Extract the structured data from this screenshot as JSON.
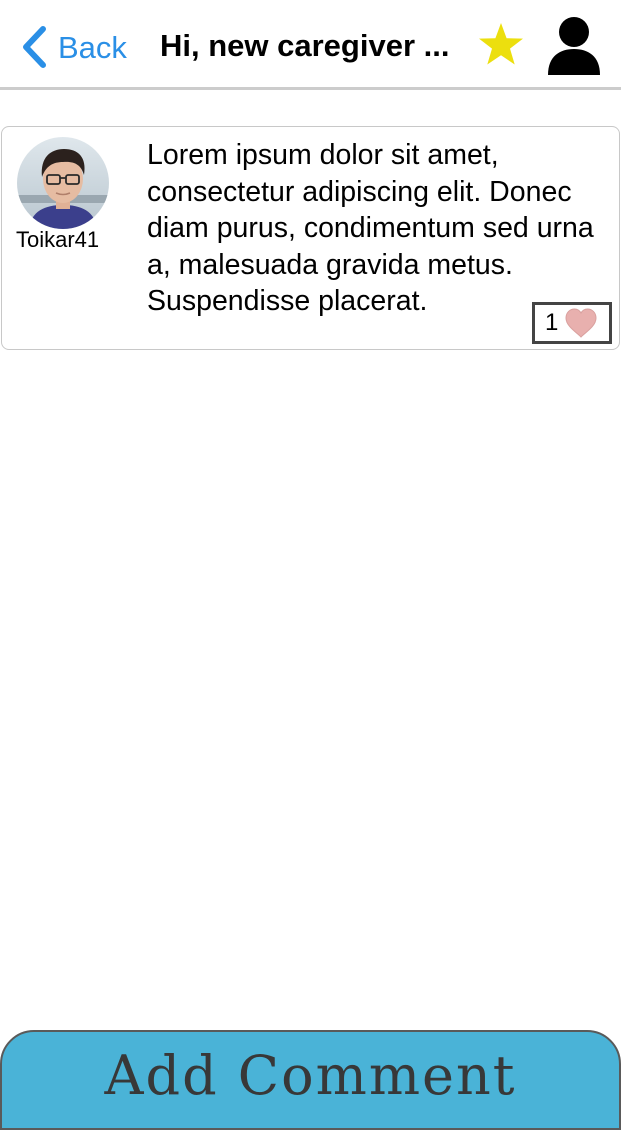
{
  "header": {
    "back_label": "Back",
    "title": "Hi, new caregiver ...",
    "favorite_color": "#ecdf0e",
    "accent_color": "#2a8fe6",
    "icons": [
      "chevron-left-icon",
      "star-icon",
      "user-icon"
    ]
  },
  "post": {
    "author": "Toikar41",
    "avatar_icon": "avatar-photo",
    "body": "Lorem ipsum dolor sit amet, consectetur adipiscing elit. Donec diam purus, condimentum sed urna a, malesuada gravida metus. Suspendisse placerat.",
    "like_count": "1",
    "like_icon": "heart-icon",
    "heart_color": "#e8b0ae"
  },
  "footer": {
    "add_comment_label": "Add Comment",
    "button_color": "#4ab3d7"
  }
}
